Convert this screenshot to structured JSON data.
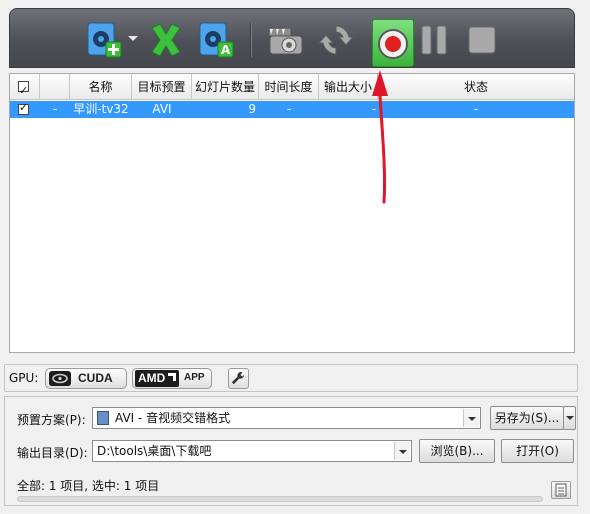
{
  "toolbar": {
    "buttons": [
      {
        "name": "add-file-icon",
        "label": ""
      },
      {
        "name": "remove-icon",
        "label": ""
      },
      {
        "name": "add-photo-album-icon",
        "label": "A"
      },
      {
        "name": "snapshot-camera-icon",
        "label": ""
      },
      {
        "name": "convert-refresh-icon",
        "label": ""
      },
      {
        "name": "record-start-icon",
        "label": ""
      },
      {
        "name": "pause-icon",
        "label": ""
      },
      {
        "name": "stop-icon",
        "label": ""
      }
    ]
  },
  "list": {
    "columns": [
      "",
      "",
      "名称",
      "目标预置",
      "幻灯片数量",
      "时间长度",
      "输出大小",
      "状态"
    ],
    "rows": [
      {
        "checked": true,
        "col2": "-",
        "name": "早训-tv32",
        "preset": "AVI",
        "slides": "9",
        "duration": "-",
        "size": "-",
        "status": "-"
      }
    ]
  },
  "gpu": {
    "label": "GPU:",
    "cuda": "CUDA",
    "amd": "AMD",
    "app": "APP"
  },
  "settings": {
    "preset_label": "预置方案(P):",
    "preset_value": "AVI - 音视频交错格式",
    "save_as": "另存为(S)...",
    "output_label": "输出目录(D):",
    "output_value": "D:\\tools\\桌面\\下载吧",
    "browse": "浏览(B)...",
    "open": "打开(O)"
  },
  "status": {
    "summary": "全部: 1 项目, 选中: 1 项目"
  },
  "colors": {
    "selection": "#3399ff",
    "record_green": "#2fb52f",
    "record_red": "#e02020",
    "arrow": "#e0162a"
  }
}
